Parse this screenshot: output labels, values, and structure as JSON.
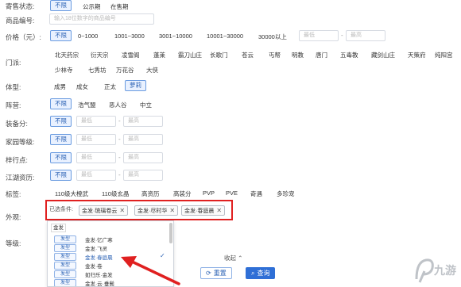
{
  "filters": {
    "sale_status": {
      "label": "寄售状态:",
      "options": [
        "不限",
        "公示期",
        "在售期"
      ]
    },
    "product_no": {
      "label": "商品编号:",
      "placeholder": "输入18位数字的商品编号"
    },
    "price": {
      "label": "价格（元）:",
      "options": [
        "不限",
        "0~1000",
        "1001~3000",
        "3001~10000",
        "10001~30000",
        "30000以上"
      ],
      "min_placeholder": "最低",
      "max_placeholder": "最高",
      "sep": "-"
    },
    "sect": {
      "label": "门派:",
      "options_row1": [
        "北天药宗",
        "衍天宗",
        "凌雪阁",
        "蓬莱",
        "霸刀山庄",
        "长歌门",
        "苍云",
        "丐帮",
        "明教",
        "唐门",
        "五毒教",
        "藏剑山庄",
        "天策府",
        "纯阳宫"
      ],
      "options_row2": [
        "少林寺",
        "七秀坊",
        "万花谷",
        "大侠"
      ]
    },
    "body_type": {
      "label": "体型:",
      "options": [
        "成男",
        "成女",
        "正太",
        "萝莉"
      ]
    },
    "camp": {
      "label": "阵营:",
      "options": [
        "不限",
        "浩气盟",
        "恶人谷",
        "中立"
      ]
    },
    "gear_score": {
      "label": "装备分:",
      "options": [
        "不限"
      ],
      "min_placeholder": "最低",
      "max_placeholder": "最高",
      "sep": "-"
    },
    "home_level": {
      "label": "家园等级:",
      "options": [
        "不限"
      ],
      "min_placeholder": "最低",
      "max_placeholder": "最高",
      "sep": "-"
    },
    "merit_points": {
      "label": "梓行点:",
      "options": [
        "不限"
      ],
      "min_placeholder": "最低",
      "max_placeholder": "最高",
      "sep": "-"
    },
    "jianghu": {
      "label": "江湖资历:",
      "options": [
        "不限"
      ],
      "min_placeholder": "最低",
      "max_placeholder": "最高",
      "sep": "-"
    },
    "tags": {
      "label": "标签:",
      "options": [
        "110级大橙武",
        "110级玄晶",
        "高资历",
        "高装分",
        "PVP",
        "PVE",
        "奇遇",
        "多珍宠"
      ]
    },
    "appearance": {
      "label": "外观:",
      "selected_label": "已选条件:",
      "selected": [
        "金发·琉璃卷云",
        "金发·尽时华",
        "金发·春庭晨"
      ],
      "search_value": "金发",
      "items": [
        {
          "type": "发型",
          "name": "金发·忆广寒",
          "checked": false
        },
        {
          "type": "发型",
          "name": "金发·飞灵",
          "checked": false
        },
        {
          "type": "发型",
          "name": "金发·春庭晨",
          "checked": true
        },
        {
          "type": "发型",
          "name": "金发·卷",
          "checked": false
        },
        {
          "type": "发型",
          "name": "如归乐·金发",
          "checked": false
        },
        {
          "type": "发型",
          "name": "金发·云·垂鬓",
          "checked": false
        }
      ]
    },
    "level": {
      "label": "等级:"
    }
  },
  "actions": {
    "collapse_label": "收起",
    "reset_label": "重置",
    "query_label": "查询"
  },
  "watermark": "九游",
  "colors": {
    "accent": "#2f6fd6",
    "highlight_box": "#e02020",
    "arrow": "#e02020"
  }
}
